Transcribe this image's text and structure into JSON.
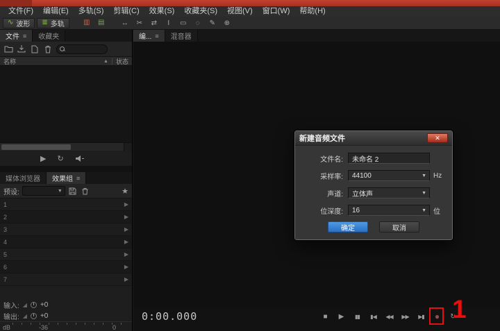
{
  "menubar": {
    "items": [
      "文件(F)",
      "编辑(E)",
      "多轨(S)",
      "剪辑(C)",
      "效果(S)",
      "收藏夹(S)",
      "视图(V)",
      "窗口(W)",
      "帮助(H)"
    ]
  },
  "toolbar": {
    "waveform": "波形",
    "multitrack": "多轨",
    "tool_glyphs": [
      "↔",
      "✂",
      "⇄",
      "I",
      "▭",
      "◌",
      "✎",
      "⊕"
    ]
  },
  "icons": {
    "waveform_glyph": "∿",
    "multitrack_glyph": "≣",
    "spectral_glyph": "▥",
    "pitch_glyph": "▤",
    "menu_glyph": "≡",
    "sort_asc_glyph": "▲",
    "dropdown_glyph": "▼",
    "star_glyph": "★",
    "play_glyph": "▶",
    "loop_glyph": "↻",
    "slot_arrow_glyph": "▶",
    "fader_glyph": "◢"
  },
  "files_panel": {
    "tab_files": "文件",
    "tab_favorites": "收藏夹",
    "col_name": "名称",
    "col_status": "状态"
  },
  "effects_panel": {
    "tab_media_browser": "媒体浏览器",
    "tab_effects_rack": "效果组",
    "presets_label": "预设:",
    "slots": [
      "1",
      "2",
      "3",
      "4",
      "5",
      "6",
      "7"
    ]
  },
  "meters": {
    "input_label": "输入:",
    "input_value": "+0",
    "output_label": "输出:",
    "output_value": "+0",
    "scale_db": "dB",
    "scale_minus36": "-36",
    "scale_zero": "0"
  },
  "editor": {
    "tab_editor": "编...",
    "tab_mixer": "混音器",
    "time_display": "0:00.000"
  },
  "transport": {
    "stop": "■",
    "play": "▶",
    "pause": "▮▮",
    "to_start": "▮◀",
    "rewind": "◀◀",
    "forward": "▶▶",
    "to_end": "▶▮",
    "record": "●",
    "loop": "↻"
  },
  "dialog": {
    "title": "新建音频文件",
    "close": "✕",
    "filename_label": "文件名:",
    "filename_value": "未命名 2",
    "samplerate_label": "采样率:",
    "samplerate_value": "44100",
    "samplerate_unit": "Hz",
    "channels_label": "声道:",
    "channels_value": "立体声",
    "bitdepth_label": "位深度:",
    "bitdepth_value": "16",
    "bitdepth_unit": "位",
    "ok": "确定",
    "cancel": "取消"
  },
  "annotation": {
    "step": "1"
  }
}
